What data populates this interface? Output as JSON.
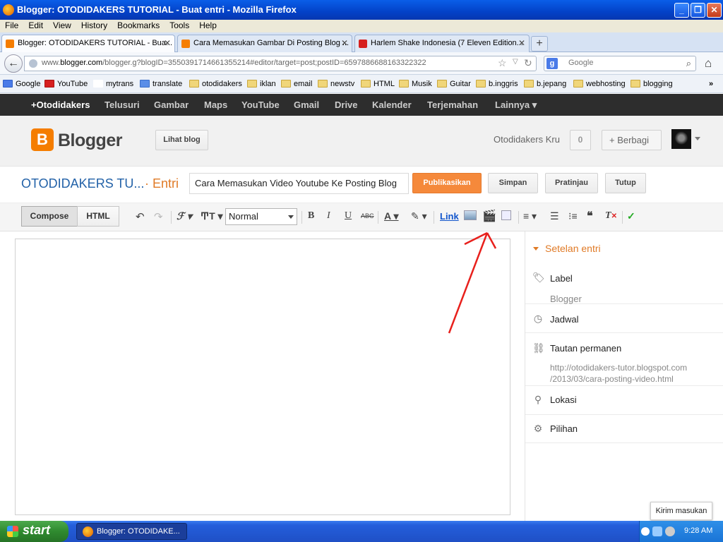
{
  "window": {
    "title": "Blogger: OTODIDAKERS TUTORIAL - Buat entri - Mozilla Firefox"
  },
  "menu": [
    "File",
    "Edit",
    "View",
    "History",
    "Bookmarks",
    "Tools",
    "Help"
  ],
  "tabs": [
    {
      "label": "Blogger: OTODIDAKERS TUTORIAL - Bua...",
      "active": true
    },
    {
      "label": "Cara Memasukan Gambar Di Posting Blog ...",
      "active": false
    },
    {
      "label": "Harlem Shake Indonesia (7 Eleven Edition...",
      "active": false
    }
  ],
  "address": {
    "prefix": "www.",
    "domain": "blogger.com",
    "path": "/blogger.g?blogID=3550391714661355214#editor/target=post;postID=6597886688163322322"
  },
  "search": {
    "placeholder": "Google"
  },
  "bookmarks": [
    "Google",
    "YouTube",
    "mytrans",
    "translate",
    "otodidakers",
    "iklan",
    "email",
    "newstv",
    "HTML",
    "Musik",
    "Guitar",
    "b.inggris",
    "b.jepang",
    "webhosting",
    "blogging"
  ],
  "gbar": [
    "+Otodidakers",
    "Telusuri",
    "Gambar",
    "Maps",
    "YouTube",
    "Gmail",
    "Drive",
    "Kalender",
    "Terjemahan",
    "Lainnya ▾"
  ],
  "header": {
    "brand": "Blogger",
    "view_blog": "Lihat blog",
    "user": "Otodidakers Kru",
    "notifications": "0",
    "share": "+ Berbagi"
  },
  "post": {
    "blog_title": "OTODIDAKERS TU...",
    "entry_label": "· Entri",
    "title_value": "Cara Memasukan Video Youtube Ke Posting Blog",
    "publish": "Publikasikan",
    "save": "Simpan",
    "preview": "Pratinjau",
    "close": "Tutup"
  },
  "toolbar": {
    "compose": "Compose",
    "html": "HTML",
    "format": "Normal",
    "link": "Link",
    "bold": "B",
    "italic": "I",
    "underline": "U",
    "strike": "ABC"
  },
  "settings": {
    "title": "Setelan entri",
    "label": "Label",
    "label_value": "Blogger",
    "schedule": "Jadwal",
    "permalink": "Tautan permanen",
    "permalink_line1": "http://otodidakers-tutor.blogspot.com",
    "permalink_line2": "/2013/03/cara-posting-video.html",
    "location": "Lokasi",
    "options": "Pilihan"
  },
  "feedback": "Kirim masukan",
  "taskbar": {
    "start": "start",
    "app": "Blogger: OTODIDAKE...",
    "clock": "9:28 AM"
  },
  "colors": {
    "accent_orange": "#f5893b",
    "blog_blue": "#2362a8",
    "annotation_red": "#e8201c"
  }
}
